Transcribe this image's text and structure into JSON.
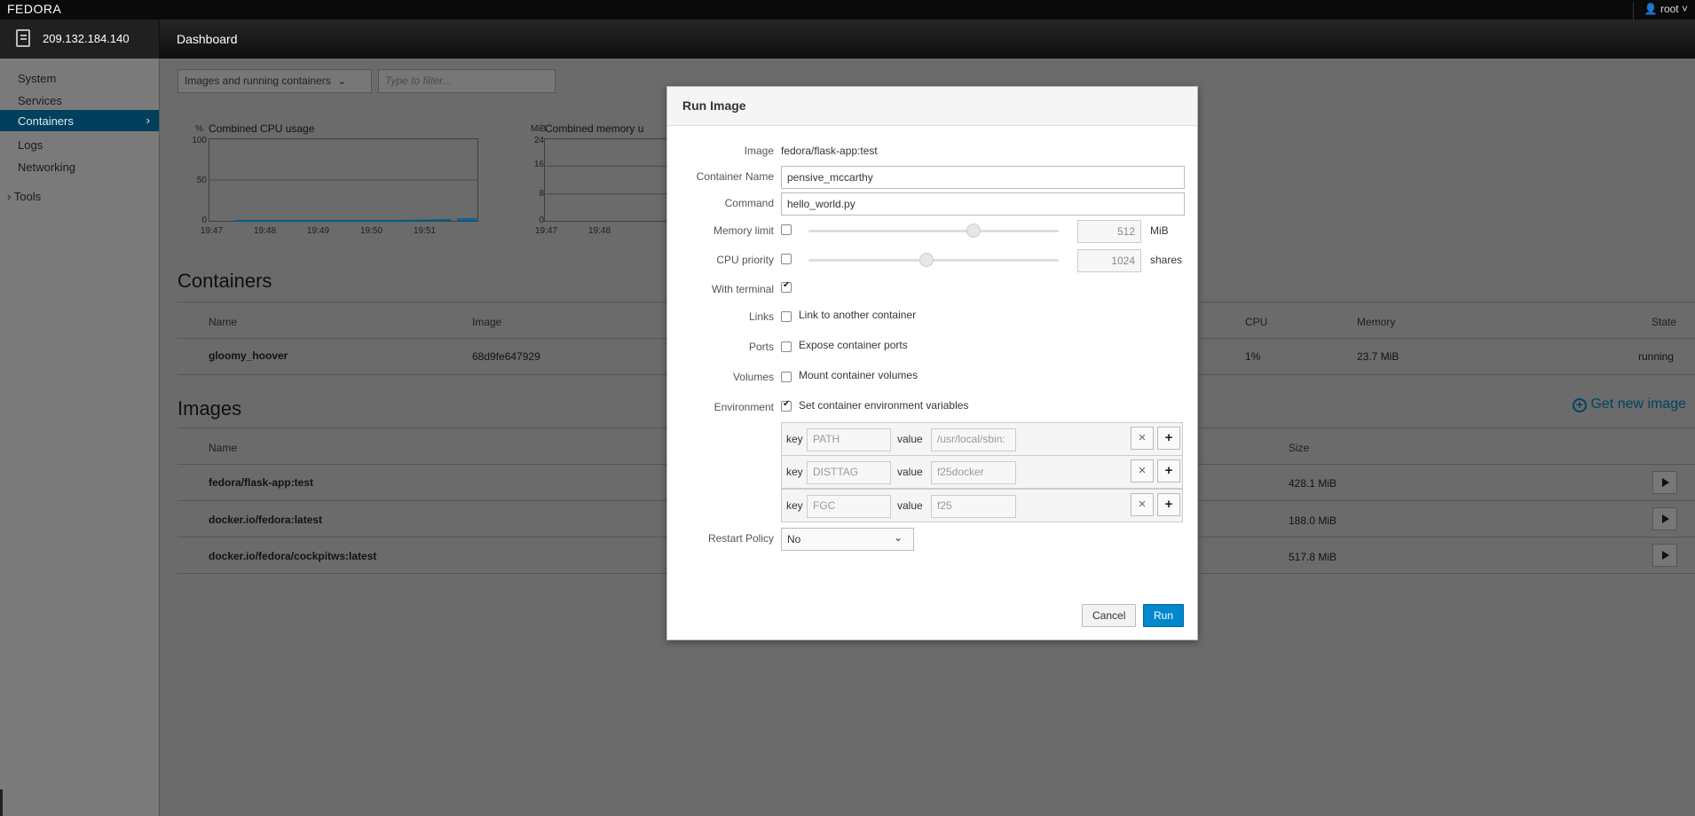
{
  "topbar": {
    "brand": "FEDORA",
    "user": "root",
    "user_icon": "user-icon",
    "user_caret": "˅"
  },
  "host": {
    "address": "209.132.184.140",
    "icon": "server-icon"
  },
  "header": {
    "title": "Dashboard"
  },
  "sidebar": {
    "items": [
      {
        "label": "System"
      },
      {
        "label": "Services"
      },
      {
        "label": "Containers",
        "chevron": "›"
      },
      {
        "label": "Logs"
      },
      {
        "label": "Networking"
      }
    ],
    "tools": {
      "chevron": "›",
      "label": "Tools"
    }
  },
  "filterbar": {
    "dropdown": "Images and running containers",
    "dropdown_caret": "⌄",
    "search_placeholder": "Type to filter..."
  },
  "chart_data": [
    {
      "type": "line",
      "title": "Combined CPU usage",
      "ylabel": "%",
      "yticks": [
        "100",
        "50",
        "0"
      ],
      "ylim": [
        0,
        100
      ],
      "x": [
        "19:47",
        "19:48",
        "19:49",
        "19:50",
        "19:51"
      ],
      "series": [
        {
          "values": [
            0,
            0,
            0,
            0,
            1
          ]
        }
      ]
    },
    {
      "type": "line",
      "title": "Combined memory u",
      "ylabel": "MiB",
      "yticks": [
        "24",
        "16",
        "8",
        "0"
      ],
      "ylim": [
        0,
        24
      ],
      "x": [
        "19:47",
        "19:48"
      ]
    }
  ],
  "containers": {
    "heading": "Containers",
    "columns": {
      "name": "Name",
      "image": "Image",
      "cpu": "CPU",
      "memory": "Memory",
      "state": "State"
    },
    "rows": [
      {
        "name": "gloomy_hoover",
        "image": "68d9fe647929",
        "cpu": "1%",
        "memory": "23.7 MiB",
        "state": "running"
      }
    ]
  },
  "images": {
    "heading": "Images",
    "get_new_icon": "plus-circle-icon",
    "get_new": "Get new image",
    "columns": {
      "name": "Name",
      "size": "Size"
    },
    "rows": [
      {
        "name": "fedora/flask-app:test",
        "size": "428.1 MiB"
      },
      {
        "name": "docker.io/fedora:latest",
        "size": "188.0 MiB"
      },
      {
        "name": "docker.io/fedora/cockpitws:latest",
        "size": "517.8 MiB"
      }
    ]
  },
  "modal": {
    "title": "Run Image",
    "labels": {
      "image": "Image",
      "container_name": "Container Name",
      "command": "Command",
      "memory_limit": "Memory limit",
      "cpu_priority": "CPU priority",
      "with_terminal": "With terminal",
      "links": "Links",
      "ports": "Ports",
      "volumes": "Volumes",
      "environment": "Environment",
      "restart_policy": "Restart Policy"
    },
    "image_value": "fedora/flask-app:test",
    "container_name_value": "pensive_mccarthy",
    "command_value": "hello_world.py",
    "memory": {
      "checked": false,
      "value": "512",
      "unit": "MiB",
      "slider_level": 0.66
    },
    "cpu": {
      "checked": false,
      "value": "1024",
      "unit": "shares",
      "slider_level": 0.47
    },
    "with_terminal_checked": true,
    "links_text": "Link to another container",
    "links_checked": false,
    "ports_text": "Expose container ports",
    "ports_checked": false,
    "volumes_text": "Mount container volumes",
    "volumes_checked": false,
    "env_text": "Set container environment variables",
    "env_checked": true,
    "env_key_label": "key",
    "env_value_label": "value",
    "env_remove_icon": "×",
    "env_add_icon": "+",
    "env_rows": [
      {
        "key": "PATH",
        "value": "/usr/local/sbin:"
      },
      {
        "key": "DISTTAG",
        "value": "f25docker"
      },
      {
        "key": "FGC",
        "value": "f25"
      }
    ],
    "restart_policy_value": "No",
    "restart_caret": "⌄",
    "cancel": "Cancel",
    "run": "Run"
  }
}
